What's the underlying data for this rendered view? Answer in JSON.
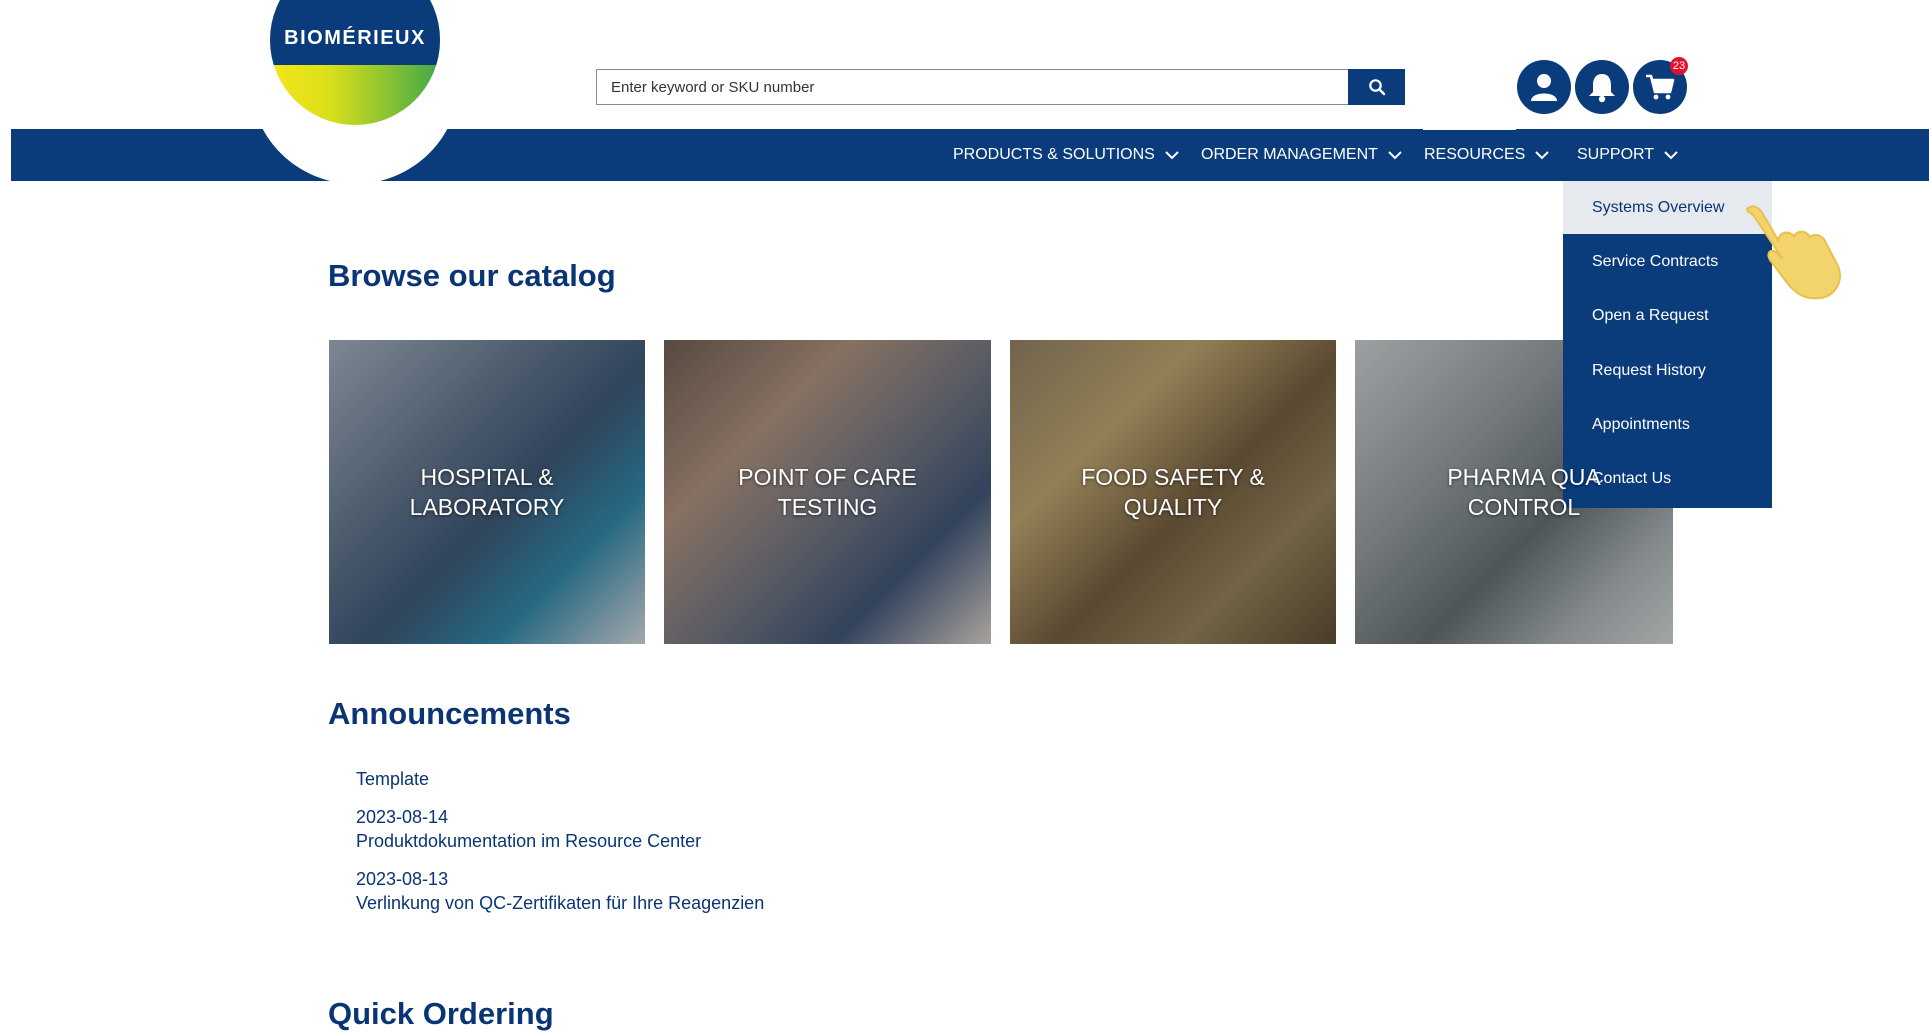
{
  "brand": {
    "logo_text": "BIOMÉRIEUX"
  },
  "search": {
    "placeholder": "Enter keyword or SKU number",
    "value": ""
  },
  "header_icons": [
    {
      "name": "account-icon"
    },
    {
      "name": "notifications-icon"
    },
    {
      "name": "cart-icon",
      "badge": "23"
    }
  ],
  "nav": {
    "items": [
      {
        "label": "PRODUCTS & SOLUTIONS"
      },
      {
        "label": "ORDER MANAGEMENT"
      },
      {
        "label": "RESOURCES"
      },
      {
        "label": "SUPPORT"
      }
    ]
  },
  "support_menu": {
    "items": [
      {
        "label": "Systems Overview",
        "active": true
      },
      {
        "label": "Service Contracts"
      },
      {
        "label": "Open a Request"
      },
      {
        "label": "Request History"
      },
      {
        "label": "Appointments"
      },
      {
        "label": "Contact Us"
      }
    ]
  },
  "catalog": {
    "title": "Browse our catalog",
    "tiles": [
      {
        "line1": "HOSPITAL &",
        "line2": "LABORATORY"
      },
      {
        "line1": "POINT OF CARE",
        "line2": "TESTING"
      },
      {
        "line1": "FOOD SAFETY &",
        "line2": "QUALITY"
      },
      {
        "line1": "PHARMA QUA",
        "line2": "CONTROL"
      }
    ]
  },
  "announcements": {
    "title": "Announcements",
    "items": [
      {
        "date": "",
        "text": "Template"
      },
      {
        "date": "2023-08-14",
        "text": "Produktdokumentation im Resource Center"
      },
      {
        "date": "2023-08-13",
        "text": "Verlinkung von QC-Zertifikaten für Ihre Reagenzien"
      }
    ]
  },
  "quick_ordering": {
    "title": "Quick Ordering"
  },
  "colors": {
    "brand_blue": "#0a3b7b",
    "badge_red": "#e2142d",
    "active_item_bg": "#e6eaef"
  }
}
